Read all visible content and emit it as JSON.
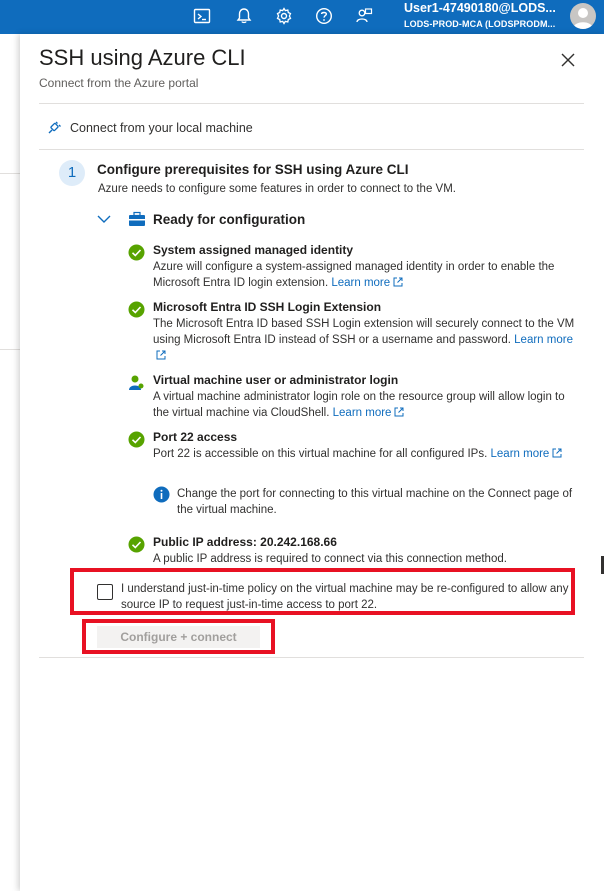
{
  "topbar": {
    "icons": [
      "cloud-shell-icon",
      "notifications-icon",
      "settings-icon",
      "help-icon",
      "feedback-icon"
    ],
    "user_name": "User1-47490180@LODS...",
    "user_tenant": "LODS-PROD-MCA (LODSPRODM..."
  },
  "panel": {
    "title": "SSH using Azure CLI",
    "subtitle": "Connect from the Azure portal",
    "tab_label": "Connect from your local machine"
  },
  "step": {
    "number": "1",
    "title": "Configure prerequisites for SSH using Azure CLI",
    "description": "Azure needs to configure some features in order to connect to the VM.",
    "section_title": "Ready for configuration"
  },
  "items": [
    {
      "title": "System assigned managed identity",
      "description": "Azure will configure a system-assigned managed identity in order to enable the Microsoft Entra ID login extension.",
      "link": "Learn more",
      "icon": "check-circle-icon"
    },
    {
      "title": "Microsoft Entra ID SSH Login Extension",
      "description": "The Microsoft Entra ID based SSH Login extension will securely connect to the VM using Microsoft Entra ID instead of SSH or a username and password.",
      "link": "Learn more",
      "icon": "check-circle-icon"
    },
    {
      "title": "Virtual machine user or administrator login",
      "description": "A virtual machine administrator login role on the resource group will allow login to the virtual machine via CloudShell.",
      "link": "Learn more",
      "icon": "user-role-icon"
    },
    {
      "title": "Port 22 access",
      "description": "Port 22 is accessible on this virtual machine for all configured IPs.",
      "link": "Learn more",
      "icon": "check-circle-icon"
    },
    {
      "title": "Public IP address: 20.242.168.66",
      "description": "A public IP address is required to connect via this connection method.",
      "icon": "check-circle-icon"
    }
  ],
  "info_text": "Change the port for connecting to this virtual machine on the Connect page of the virtual machine.",
  "consent": {
    "checked": false,
    "label": "I understand just-in-time policy on the virtual machine may be re-configured to allow any source IP to request just-in-time access to port 22."
  },
  "configure_button": "Configure + connect",
  "colors": {
    "topbar": "#0f6cbd",
    "link": "#0f6cbd",
    "success": "#57a300",
    "highlight": "#e81123"
  }
}
